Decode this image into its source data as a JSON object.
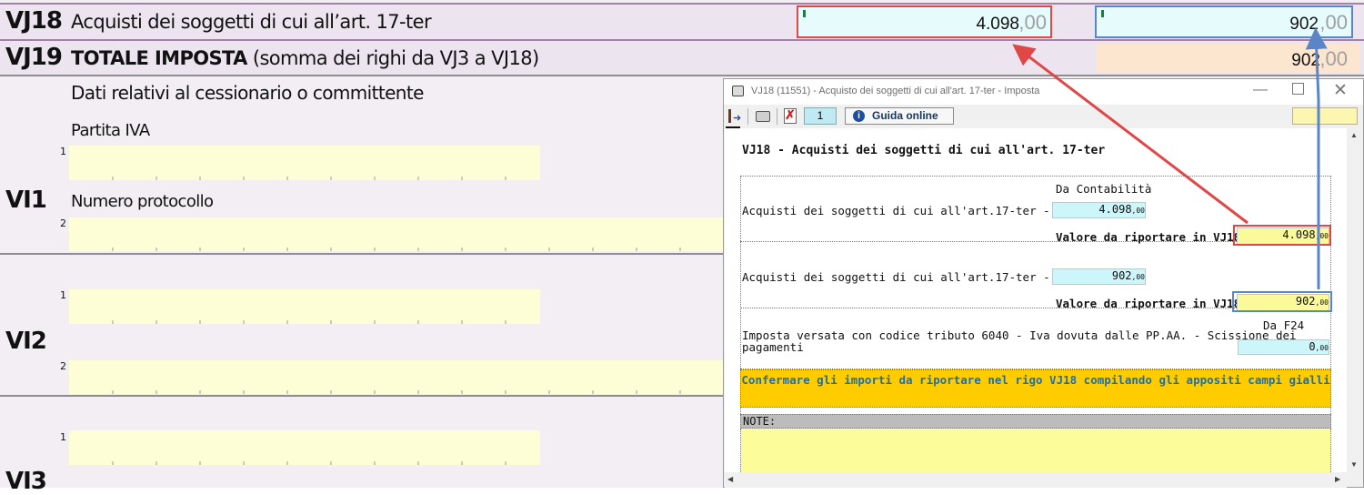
{
  "form": {
    "rows": [
      {
        "code": "VJ18",
        "label": "Acquisti dei soggetti di cui all’art. 17-ter",
        "value1_int": "4.098",
        "value1_dec": ",00",
        "value2_int": "902",
        "value2_dec": ",00"
      },
      {
        "code": "VJ19",
        "label_bold": "TOTALE IMPOSTA",
        "label_rest": " (somma dei righi da VJ3 a VJ18)",
        "value_int": "902",
        "value_dec": ",00"
      }
    ],
    "section_title": "Dati relativi al cessionario o committente",
    "vi1": {
      "code": "VI1",
      "field1_label": "Partita IVA",
      "field1_num": "1",
      "field2_label": "Numero protocollo",
      "field2_num": "2"
    },
    "vi2": {
      "code": "VI2",
      "field1_num": "1",
      "field2_num": "2"
    },
    "vi3": {
      "code": "VI3",
      "field1_num": "1"
    }
  },
  "dialog": {
    "title": "VJ18 (11551) - Acquisto dei soggetti di cui all'art. 17-ter - Imposta",
    "toolbar": {
      "page_number": "1",
      "help_label": "Guida online"
    },
    "heading": "VJ18 - Acquisti dei soggetti di cui all'art. 17-ter",
    "col_header_contabilita": "Da Contabilità",
    "imponibile_label": "Acquisti dei soggetti di cui all'art.17-ter - Imponibile",
    "imponibile_value": "4.098",
    "riportare1_label": "Valore da riportare in VJ18_1",
    "riportare1_value": "4.098",
    "imposta_label": "Acquisti dei soggetti di cui all'art.17-ter - Imposta",
    "imposta_value": "902",
    "riportare2_label": "Valore da riportare in VJ18_2",
    "riportare2_value": "902",
    "col_header_f24": "Da F24",
    "versata_label_line1": "Imposta versata con codice tributo 6040 - Iva dovuta dalle PP.AA. - Scissione dei",
    "versata_label_line2": "pagamenti",
    "versata_value": "0",
    "decimals": ",00",
    "confirm_message": "Confermare gli importi da riportare nel rigo VJ18 compilando gli appositi campi gialli",
    "note_label": "NOTE:"
  },
  "colors": {
    "red_highlight": "#e04848",
    "blue_highlight": "#5a86c8",
    "message_bg": "#ffcc00",
    "message_text": "#1e6fa8"
  }
}
